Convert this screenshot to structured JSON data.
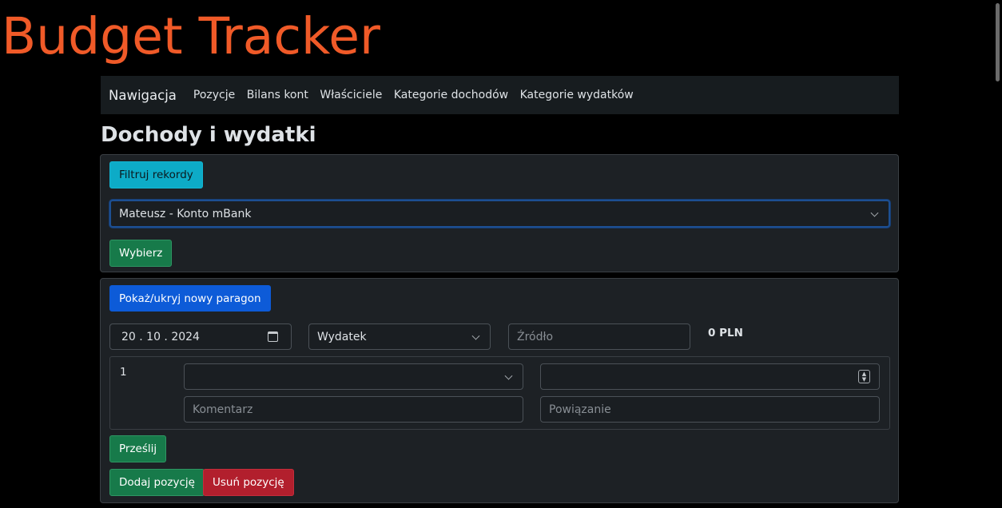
{
  "app": {
    "title": "Budget Tracker"
  },
  "navbar": {
    "brand": "Nawigacja",
    "links": [
      "Pozycje",
      "Bilans kont",
      "Właściciele",
      "Kategorie dochodów",
      "Kategorie wydatków"
    ]
  },
  "page": {
    "title": "Dochody i wydatki"
  },
  "filter": {
    "toggle_label": "Filtruj rekordy",
    "account_selected": "Mateusz - Konto mBank",
    "submit_label": "Wybierz"
  },
  "receipt": {
    "toggle_label": "Pokaż/ukryj nowy paragon",
    "date_value": "20 . 10 . 2024",
    "type_selected": "Wydatek",
    "source_placeholder": "Źródło",
    "total": "0 PLN",
    "items": [
      {
        "number": "1",
        "category_value": "",
        "amount_value": "",
        "comment_placeholder": "Komentarz",
        "link_placeholder": "Powiązanie"
      }
    ],
    "submit_label": "Prześlij",
    "add_item_label": "Dodaj pozycję",
    "remove_item_label": "Usuń pozycję"
  },
  "colors": {
    "title": "#f05a28",
    "info": "#0dabc7",
    "success": "#177a4a",
    "primary": "#0d5bd8",
    "danger": "#b21f2d"
  }
}
